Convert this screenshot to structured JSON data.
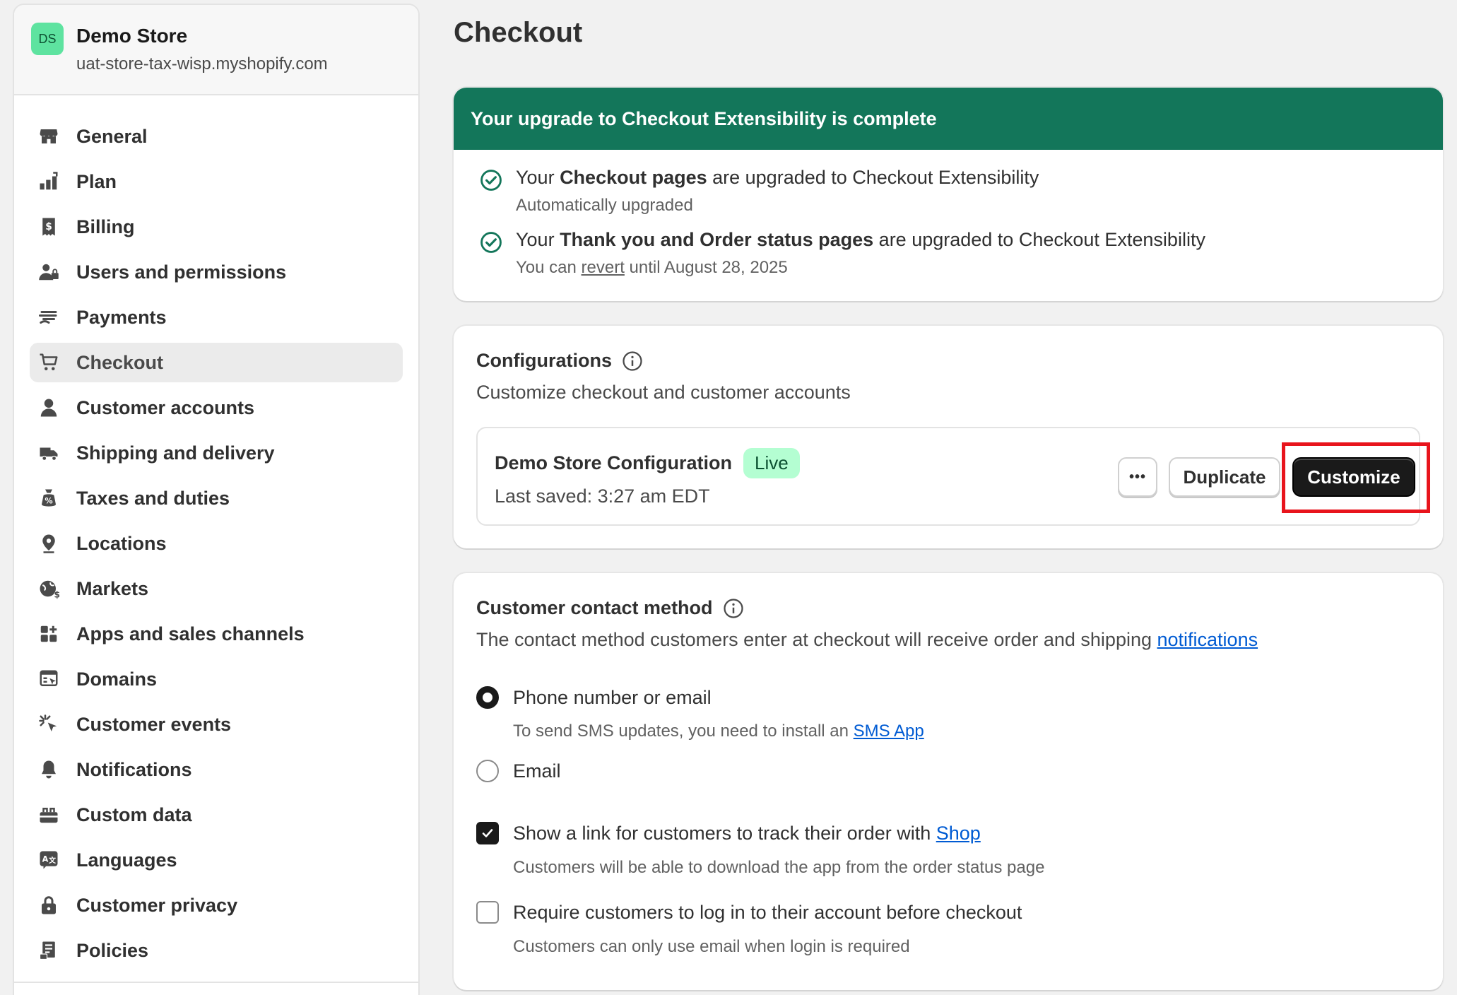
{
  "store": {
    "initials": "DS",
    "name": "Demo Store",
    "domain": "uat-store-tax-wisp.myshopify.com"
  },
  "sidebar": {
    "items": [
      {
        "label": "General",
        "icon": "store-icon"
      },
      {
        "label": "Plan",
        "icon": "plan-icon"
      },
      {
        "label": "Billing",
        "icon": "billing-icon"
      },
      {
        "label": "Users and permissions",
        "icon": "users-icon"
      },
      {
        "label": "Payments",
        "icon": "payments-icon"
      },
      {
        "label": "Checkout",
        "icon": "cart-icon",
        "active": true
      },
      {
        "label": "Customer accounts",
        "icon": "person-icon"
      },
      {
        "label": "Shipping and delivery",
        "icon": "truck-icon"
      },
      {
        "label": "Taxes and duties",
        "icon": "tax-icon"
      },
      {
        "label": "Locations",
        "icon": "location-icon"
      },
      {
        "label": "Markets",
        "icon": "globe-icon"
      },
      {
        "label": "Apps and sales channels",
        "icon": "apps-icon"
      },
      {
        "label": "Domains",
        "icon": "domains-icon"
      },
      {
        "label": "Customer events",
        "icon": "cursor-icon"
      },
      {
        "label": "Notifications",
        "icon": "bell-icon"
      },
      {
        "label": "Custom data",
        "icon": "database-icon"
      },
      {
        "label": "Languages",
        "icon": "language-icon"
      },
      {
        "label": "Customer privacy",
        "icon": "lock-icon"
      },
      {
        "label": "Policies",
        "icon": "policy-icon"
      }
    ]
  },
  "page": {
    "title": "Checkout"
  },
  "upgrade": {
    "banner": "Your upgrade to Checkout Extensibility is complete",
    "item1": {
      "prefix": "Your ",
      "bold": "Checkout pages",
      "suffix": " are upgraded to Checkout Extensibility",
      "sub": "Automatically upgraded"
    },
    "item2": {
      "prefix": "Your ",
      "bold": "Thank you and Order status pages",
      "suffix": " are upgraded to Checkout Extensibility",
      "sub_prefix": "You can ",
      "sub_link": "revert",
      "sub_suffix": " until August 28, 2025"
    }
  },
  "configurations": {
    "title": "Configurations",
    "subtitle": "Customize checkout and customer accounts",
    "config_name": "Demo Store Configuration",
    "badge": "Live",
    "last_saved": "Last saved: 3:27 am EDT",
    "more_label": "•••",
    "duplicate_label": "Duplicate",
    "customize_label": "Customize"
  },
  "contact": {
    "title": "Customer contact method",
    "subtitle_prefix": "The contact method customers enter at checkout will receive order and shipping ",
    "subtitle_link": "notifications",
    "option1": "Phone number or email",
    "option1_help_prefix": "To send SMS updates, you need to install an ",
    "option1_help_link": "SMS App",
    "option2": "Email",
    "track_prefix": "Show a link for customers to track their order with ",
    "track_link": "Shop",
    "track_help": "Customers will be able to download the app from the order status page",
    "login_label": "Require customers to log in to their account before checkout",
    "login_help": "Customers can only use email when login is required"
  }
}
